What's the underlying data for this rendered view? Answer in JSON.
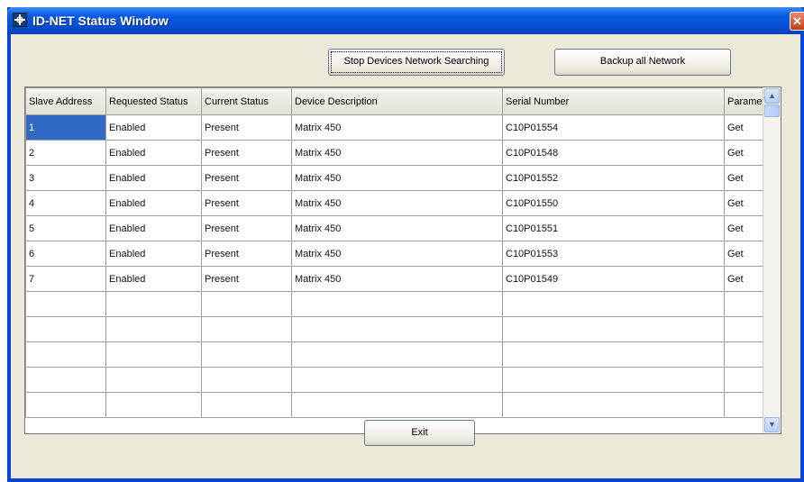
{
  "window": {
    "title": "ID-NET Status Window",
    "close_symbol": "✕"
  },
  "toolbar": {
    "stop_label": "Stop Devices Network Searching",
    "backup_label": "Backup all Network"
  },
  "table": {
    "columns": [
      "Slave Address",
      "Requested Status",
      "Current Status",
      "Device Description",
      "Serial Number",
      "Parameter"
    ],
    "rows": [
      [
        "1",
        "Enabled",
        "Present",
        "Matrix 450",
        "C10P01554",
        "Get"
      ],
      [
        "2",
        "Enabled",
        "Present",
        "Matrix 450",
        "C10P01548",
        "Get"
      ],
      [
        "3",
        "Enabled",
        "Present",
        "Matrix 450",
        "C10P01552",
        "Get"
      ],
      [
        "4",
        "Enabled",
        "Present",
        "Matrix 450",
        "C10P01550",
        "Get"
      ],
      [
        "5",
        "Enabled",
        "Present",
        "Matrix 450",
        "C10P01551",
        "Get"
      ],
      [
        "6",
        "Enabled",
        "Present",
        "Matrix 450",
        "C10P01553",
        "Get"
      ],
      [
        "7",
        "Enabled",
        "Present",
        "Matrix 450",
        "C10P01549",
        "Get"
      ]
    ],
    "empty_rows": 5,
    "selected_cell": "1"
  },
  "scrollbar": {
    "up_symbol": "▲",
    "down_symbol": "▼"
  },
  "footer": {
    "exit_label": "Exit"
  },
  "colors": {
    "titlebar": "#0a5be0",
    "selection": "#316ac5",
    "close": "#c43c12"
  },
  "icons": {
    "app": "network-cross-icon",
    "close": "close-icon"
  }
}
